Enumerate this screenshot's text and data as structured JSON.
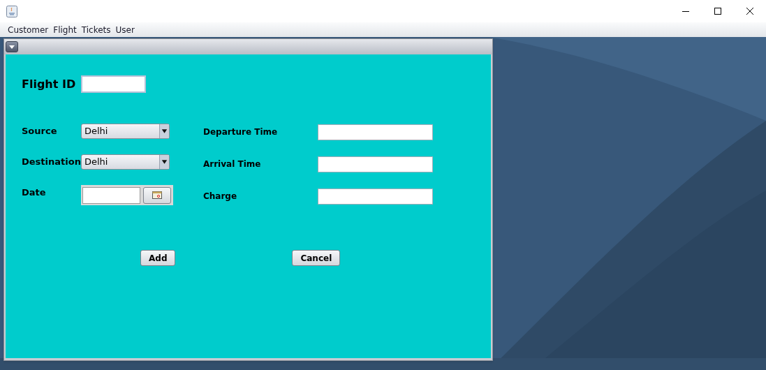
{
  "menu": [
    "Customer",
    "Flight",
    "Tickets",
    "User"
  ],
  "form": {
    "flight_id_label": "Flight ID",
    "left_fields": [
      {
        "kind": "combo",
        "label": "Source",
        "value": "Delhi"
      },
      {
        "kind": "combo",
        "label": "Destination",
        "value": "Delhi"
      },
      {
        "kind": "date",
        "label": "Date"
      }
    ],
    "right_fields": [
      {
        "kind": "text",
        "label": "Departure Time"
      },
      {
        "kind": "text",
        "label": "Arrival Time"
      },
      {
        "kind": "text",
        "label": "Charge"
      }
    ],
    "buttons": [
      "Add",
      "Cancel"
    ]
  }
}
